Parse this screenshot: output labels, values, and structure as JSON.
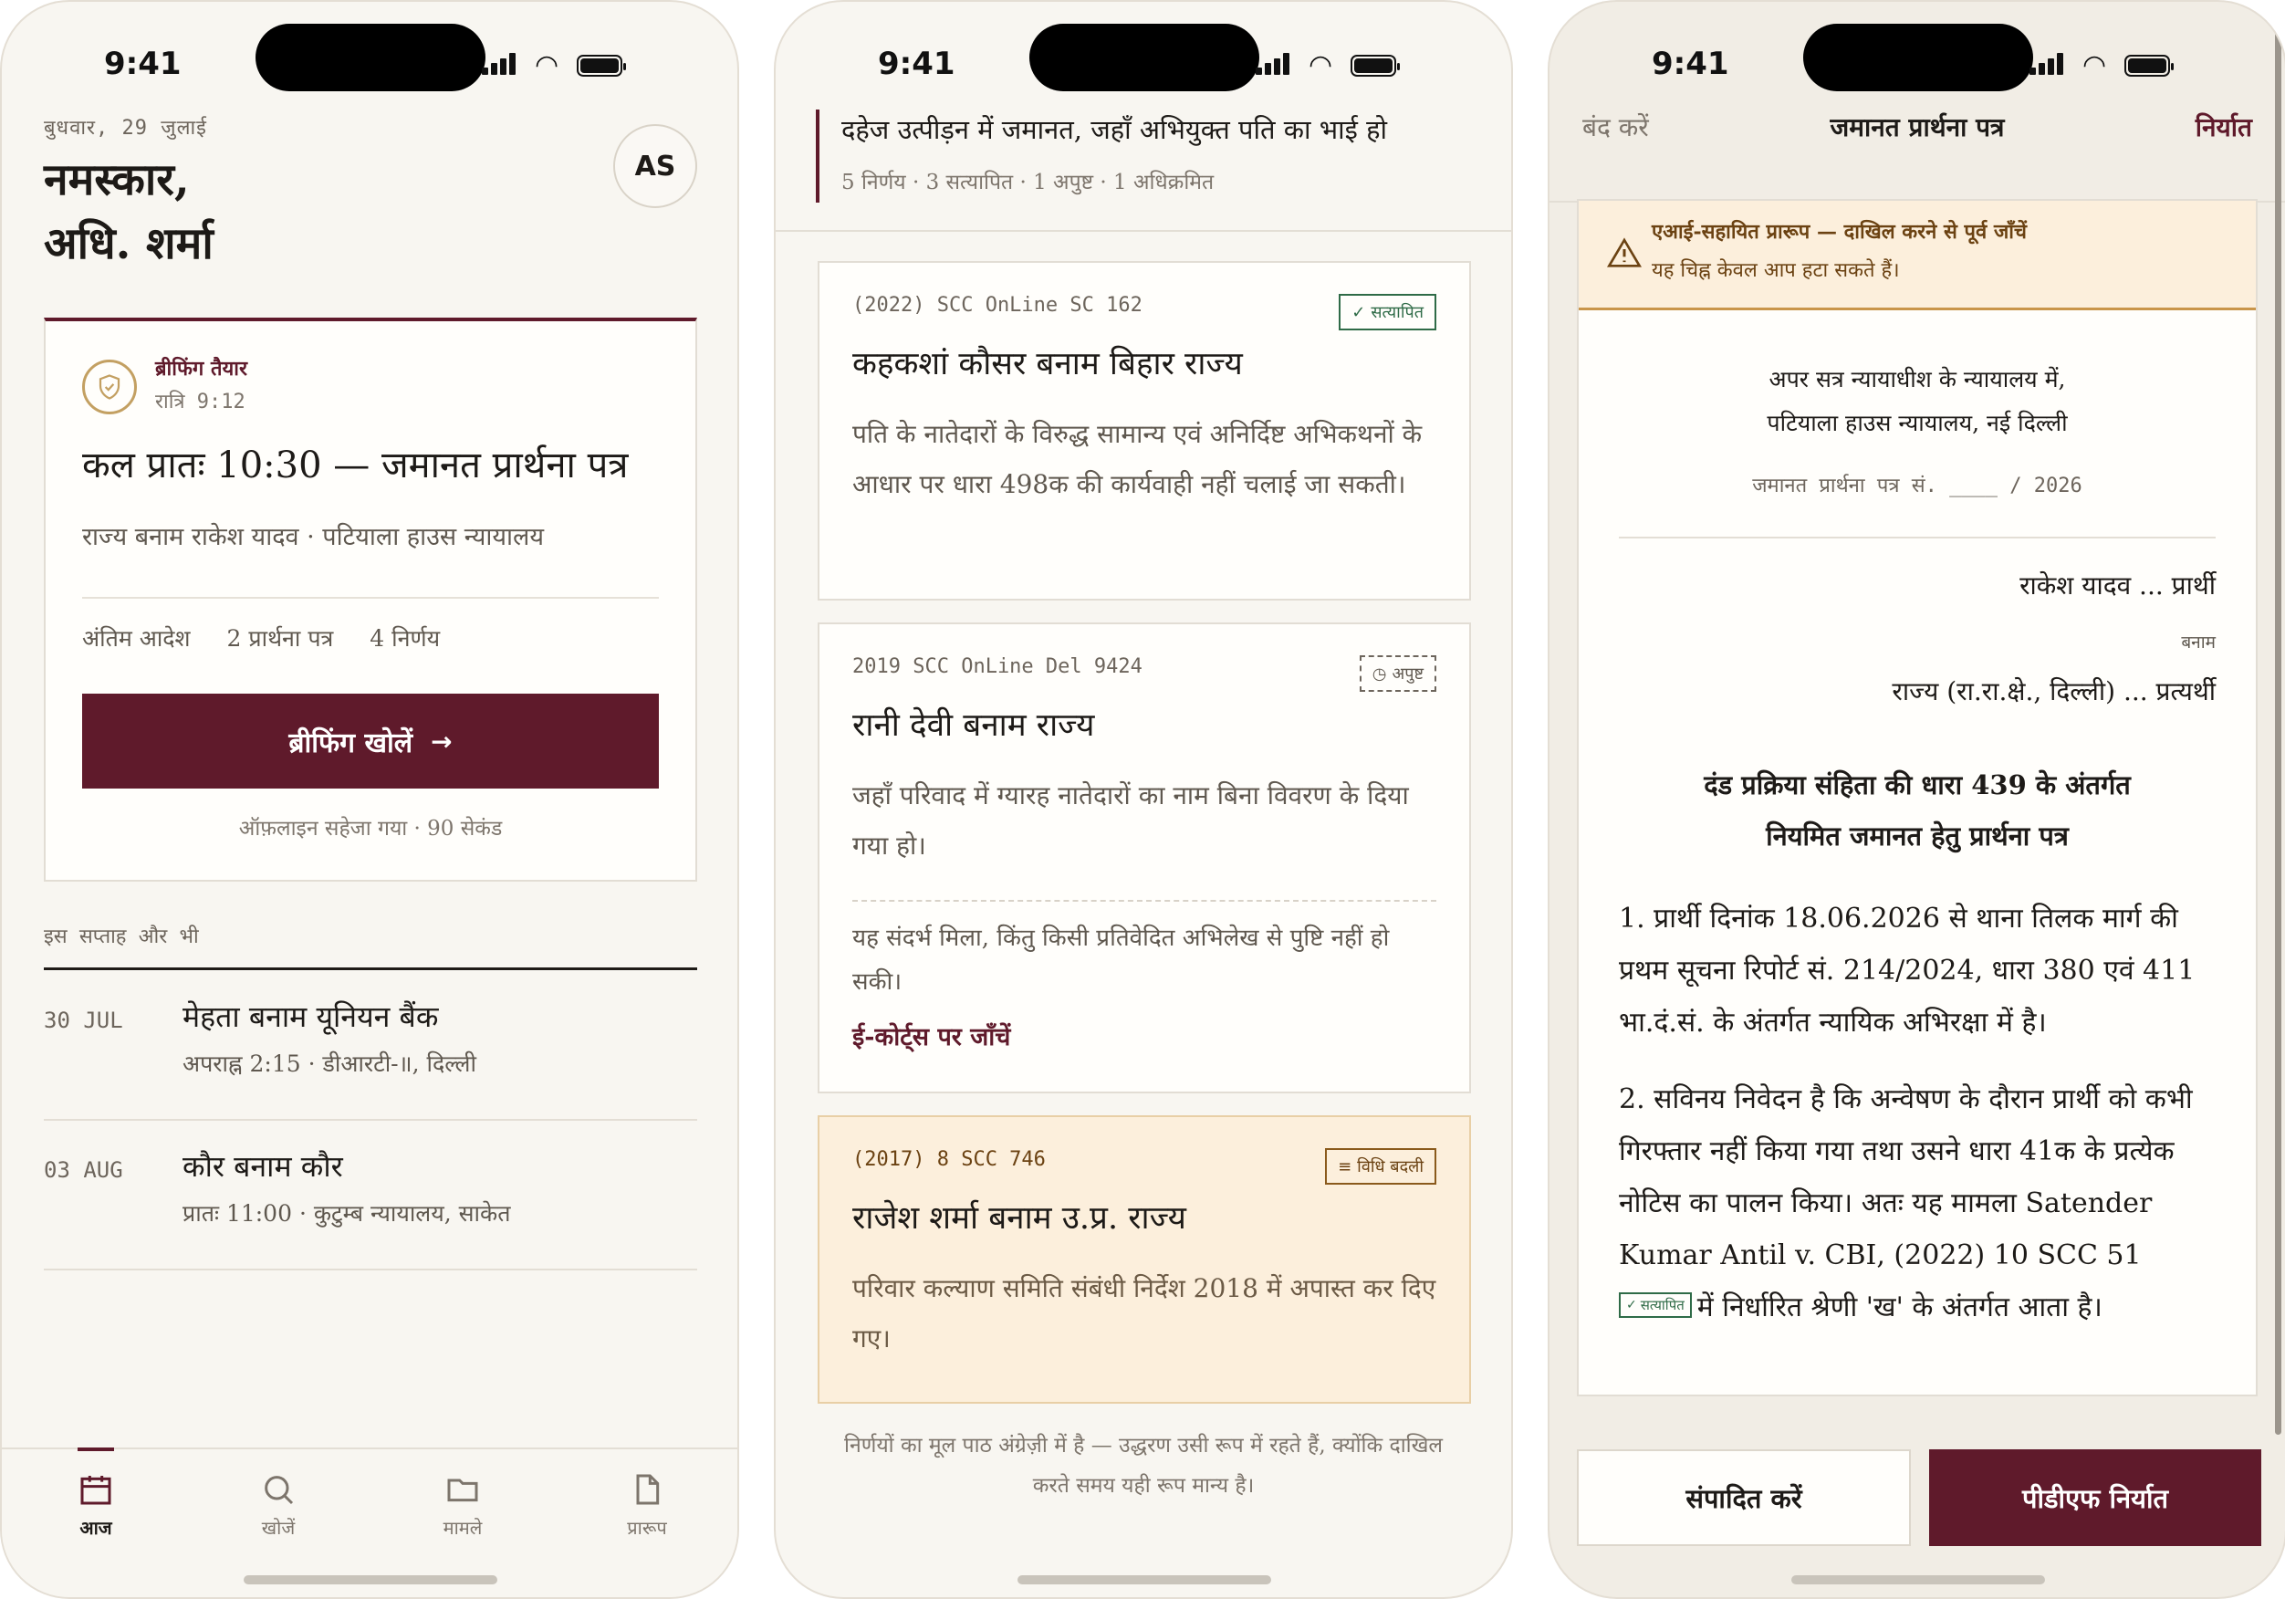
{
  "status": {
    "time": "9:41"
  },
  "home": {
    "date": "बुधवार, 29 जुलाई",
    "greeting_line1": "नमस्कार,",
    "greeting_line2": "अधि. शर्मा",
    "avatar": "AS",
    "briefing": {
      "tag": "ब्रीफिंग तैयार",
      "time": "रात्रि 9:12",
      "title": "कल प्रातः 10:30 — जमानत प्रार्थना पत्र",
      "subtitle": "राज्य बनाम राकेश यादव · पटियाला हाउस न्यायालय",
      "stats": [
        "अंतिम आदेश",
        "2 प्रार्थना पत्र",
        "4 निर्णय"
      ],
      "button": "ब्रीफिंग खोलें",
      "note": "ऑफ़लाइन सहेजा गया · 90 सेकंड"
    },
    "week_heading": "इस सप्ताह और भी",
    "cases": [
      {
        "date": "30 JUL",
        "title": "मेहता बनाम यूनियन बैंक",
        "sub": "अपराह्न 2:15 · डीआरटी-॥, दिल्ली"
      },
      {
        "date": "03 AUG",
        "title": "कौर बनाम कौर",
        "sub": "प्रातः 11:00 · कुटुम्ब न्यायालय, साकेत"
      }
    ],
    "tabs": [
      "आज",
      "खोजें",
      "मामले",
      "प्रारूप"
    ]
  },
  "search": {
    "query": "दहेज उत्पीड़न में जमानत, जहाँ अभियुक्त पति का भाई हो",
    "meta": "5 निर्णय · 3 सत्यापित · 1 अपुष्ट · 1 अधिक्रमित",
    "results": [
      {
        "citation": "(2022) SCC OnLine SC 162",
        "badge": "सत्यापित",
        "title": "कहकशां कौसर बनाम बिहार राज्य",
        "body": "पति के नातेदारों के विरुद्ध सामान्य एवं अनिर्दिष्ट अभिकथनों के आधार पर धारा 498क की कार्यवाही नहीं चलाई जा सकती।"
      },
      {
        "citation": "2019 SCC OnLine Del 9424",
        "badge": "अपुष्ट",
        "title": "रानी देवी बनाम राज्य",
        "body": "जहाँ परिवाद में ग्यारह नातेदारों का नाम बिना विवरण के दिया गया हो।",
        "warning": "यह संदर्भ मिला, किंतु किसी प्रतिवेदित अभिलेख से पुष्टि नहीं हो सकी।",
        "link": "ई-कोर्ट्स पर जाँचें"
      },
      {
        "citation": "(2017) 8 SCC 746",
        "badge": "विधि बदली",
        "title": "राजेश शर्मा बनाम उ.प्र. राज्य",
        "body": "परिवार कल्याण समिति संबंधी निर्देश 2018 में अपास्त कर दिए गए।"
      }
    ],
    "footer": "निर्णयों का मूल पाठ अंग्रेज़ी में है — उद्धरण उसी रूप में रहते हैं, क्योंकि दाखिल करते समय यही रूप मान्य है।"
  },
  "draft": {
    "close": "बंद करें",
    "title": "जमानत प्रार्थना पत्र",
    "export": "निर्यात",
    "ai_line1": "एआई-सहायित प्रारूप — दाखिल करने से पूर्व जाँचें",
    "ai_line2": "यह चिह्न केवल आप हटा सकते हैं।",
    "court_line1": "अपर सत्र न्यायाधीश के न्यायालय में,",
    "court_line2": "पटियाला हाउस न्यायालय, नई दिल्ली",
    "app_no": "जमानत प्रार्थना पत्र सं. ____ / 2026",
    "petitioner": "राकेश यादव ... प्रार्थी",
    "versus": "बनाम",
    "respondent": "राज्य (रा.रा.क्षे., दिल्ली) ... प्रत्यर्थी",
    "heading_line1": "दंड प्रक्रिया संहिता की धारा 439 के अंतर्गत",
    "heading_line2": "नियमित जमानत हेतु प्रार्थना पत्र",
    "para1": "1. प्रार्थी दिनांक 18.06.2026 से थाना तिलक मार्ग की प्रथम सूचना रिपोर्ट सं. 214/2024, धारा 380 एवं 411 भा.दं.सं. के अंतर्गत न्यायिक अभिरक्षा में है।",
    "para2_main": "2. सविनय निवेदन है कि अन्वेषण के दौरान प्रार्थी को कभी गिरफ्तार नहीं किया गया तथा उसने धारा 41क के प्रत्येक नोटिस का पालन किया। अतः यह मामला Satender Kumar Antil v. CBI, (2022) 10 SCC 51",
    "para2_badge": "सत्यापित",
    "para2_tail": "में निर्धारित श्रेणी 'ख' के अंतर्गत आता है।",
    "edit_button": "संपादित करें",
    "pdf_button": "पीडीएफ निर्यात"
  }
}
